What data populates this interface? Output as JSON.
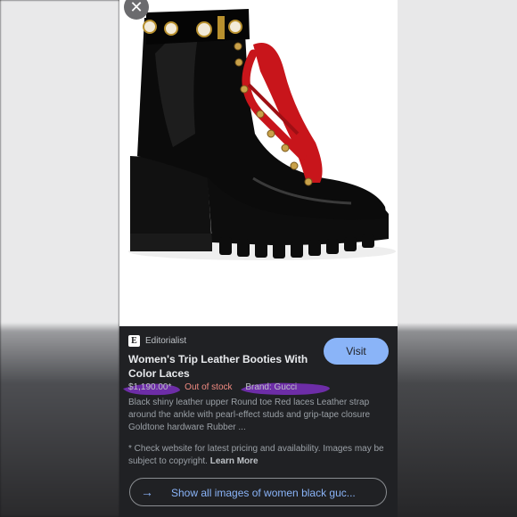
{
  "close": {
    "glyph": "✕"
  },
  "source": {
    "logo": "E",
    "name": "Editorialist"
  },
  "visit_label": "Visit",
  "product": {
    "title": "Women's Trip Leather Booties With Color Laces",
    "price": "$1,190.00*",
    "stock": "Out of stock",
    "brand": "Brand: Gucci",
    "description": "Black shiny leather upper Round toe Red laces Leather strap around the ankle with pearl-effect studs and grip-tape closure Goldtone hardware Rubber ..."
  },
  "notice": {
    "text": "* Check website for latest pricing and availability. Images may be subject to copyright.",
    "link": "Learn More"
  },
  "show_all": {
    "label": "Show all images of women black guc...",
    "icon": "→"
  },
  "colors": {
    "accent": "#8ab4f8",
    "out_of_stock": "#f28b82",
    "highlight": "#7b2fbe",
    "laces": "#c8151b"
  }
}
